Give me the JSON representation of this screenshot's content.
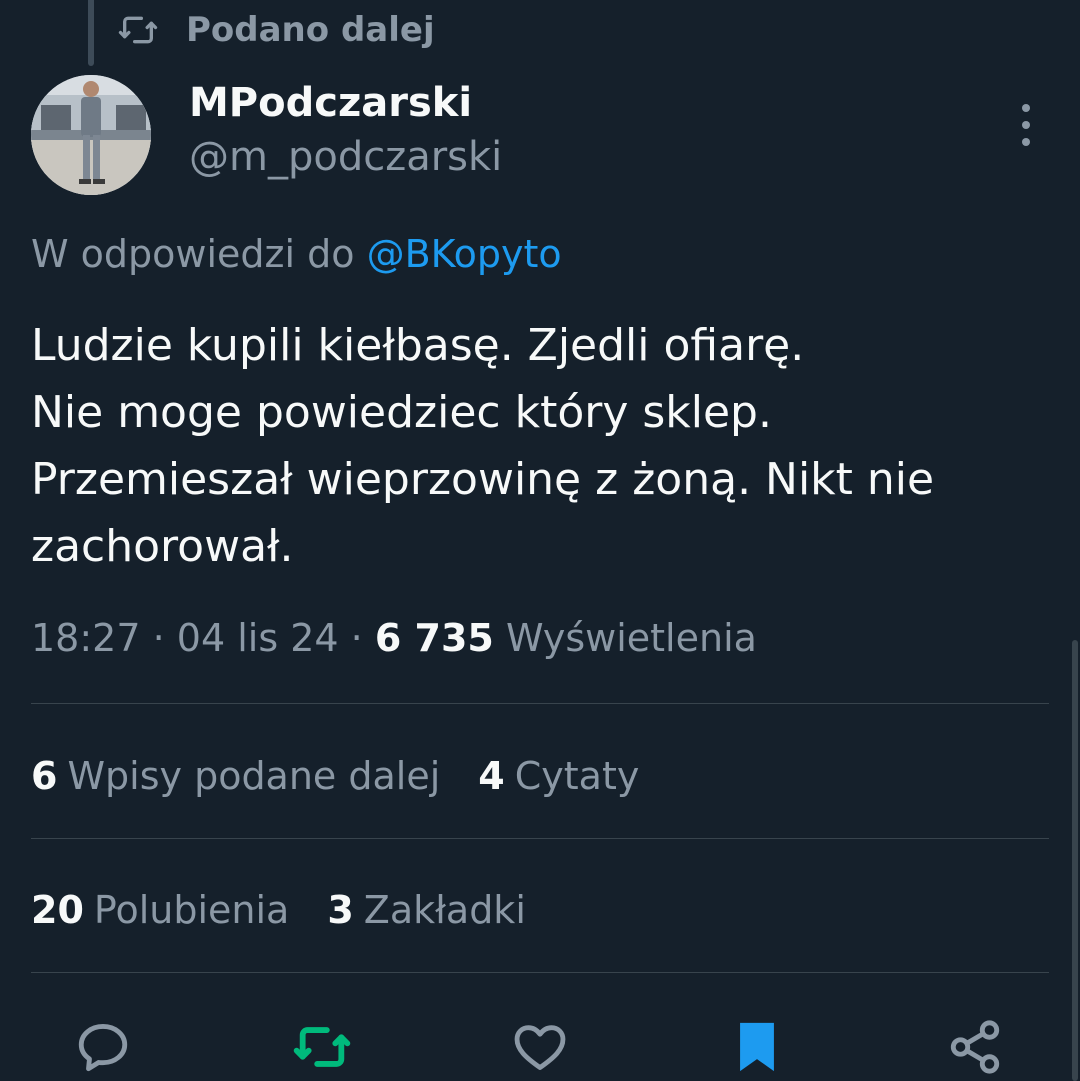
{
  "retweet_context": {
    "label": "Podano dalej",
    "icon": "retweet-icon"
  },
  "author": {
    "display_name": "MPodczarski",
    "handle": "@m_podczarski",
    "avatar": "avatar-photo"
  },
  "reply_to": {
    "prefix": "W odpowiedzi do",
    "mention": "@BKopyto"
  },
  "tweet": {
    "lines": [
      "Ludzie kupili kiełbasę. Zjedli ofiarę.",
      "Nie moge powiedziec który sklep.",
      "Przemieszał wieprzowinę z żoną. Nikt nie",
      "zachorował."
    ]
  },
  "meta": {
    "time": "18:27",
    "separator": "·",
    "date": "04 lis 24",
    "views_count": "6 735",
    "views_label": "Wyświetlenia"
  },
  "stats": {
    "retweets": {
      "count": "6",
      "label": "Wpisy podane dalej"
    },
    "quotes": {
      "count": "4",
      "label": "Cytaty"
    },
    "likes": {
      "count": "20",
      "label": "Polubienia"
    },
    "bookmarks": {
      "count": "3",
      "label": "Zakładki"
    }
  },
  "actions": [
    {
      "name": "reply",
      "icon": "reply-icon"
    },
    {
      "name": "retweet",
      "icon": "retweet-icon",
      "active_color": "#00ba7c"
    },
    {
      "name": "like",
      "icon": "heart-icon"
    },
    {
      "name": "bookmark",
      "icon": "bookmark-icon",
      "active_color": "#1d9bf0"
    },
    {
      "name": "share",
      "icon": "share-icon"
    }
  ],
  "colors": {
    "background": "#15202b",
    "primary_text": "#f7f9f9",
    "secondary_text": "#8b98a5",
    "link": "#1d9bf0",
    "retweet_active": "#00ba7c",
    "bookmark_active": "#1d9bf0",
    "divider": "#38444d"
  }
}
